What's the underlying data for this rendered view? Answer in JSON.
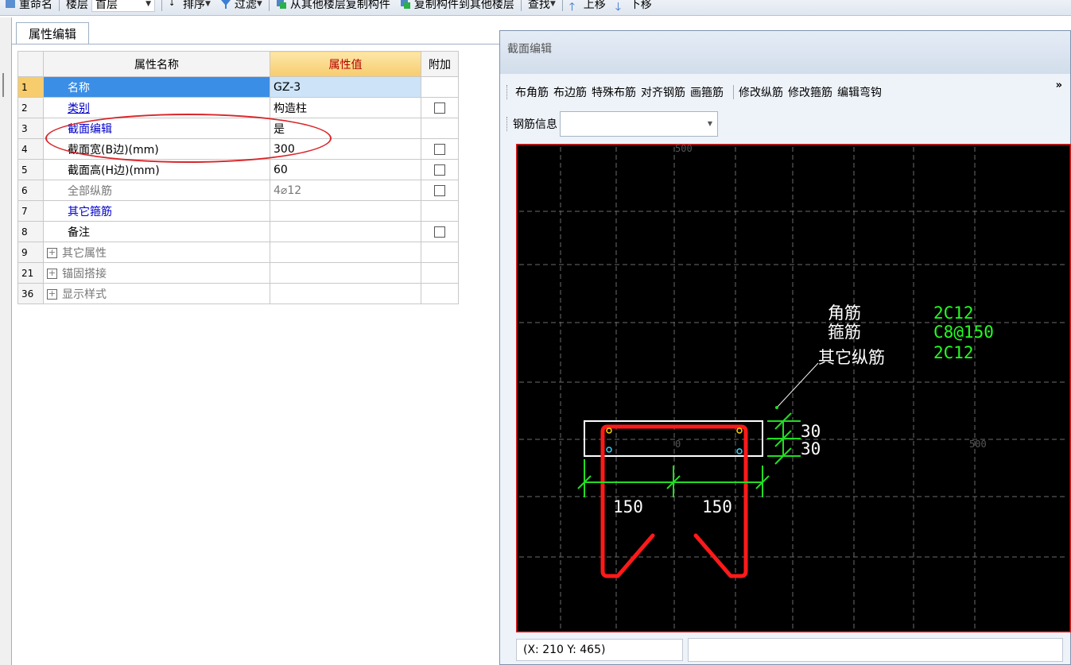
{
  "toolbar": {
    "rename_label": "重命名",
    "floor_label": "楼层",
    "floor_value": "首层",
    "sort_label": "排序",
    "filter_label": "过滤",
    "copy_from_label": "从其他楼层复制构件",
    "copy_to_label": "复制构件到其他楼层",
    "find_label": "查找",
    "move_up_label": "上移",
    "move_down_label": "下移"
  },
  "panel": {
    "tab_label": "属性编辑",
    "headers": {
      "name": "属性名称",
      "value": "属性值",
      "extra": "附加"
    },
    "rows": [
      {
        "num": "1",
        "name": "名称",
        "value": "GZ-3"
      },
      {
        "num": "2",
        "name": "类别",
        "value": "构造柱"
      },
      {
        "num": "3",
        "name": "截面编辑",
        "value": "是"
      },
      {
        "num": "4",
        "name": "截面宽(B边)(mm)",
        "value": "300"
      },
      {
        "num": "5",
        "name": "截面高(H边)(mm)",
        "value": "60"
      },
      {
        "num": "6",
        "name": "全部纵筋",
        "value": "4⌀12"
      },
      {
        "num": "7",
        "name": "其它箍筋",
        "value": ""
      },
      {
        "num": "8",
        "name": "备注",
        "value": ""
      },
      {
        "num": "9",
        "name": "其它属性",
        "value": ""
      },
      {
        "num": "21",
        "name": "锚固搭接",
        "value": ""
      },
      {
        "num": "36",
        "name": "显示样式",
        "value": ""
      }
    ]
  },
  "section_window": {
    "title": "截面编辑",
    "tools": [
      "布角筋",
      "布边筋",
      "特殊布筋",
      "对齐钢筋",
      "画箍筋",
      "修改纵筋",
      "修改箍筋",
      "编辑弯钩"
    ],
    "more": "»",
    "rebar_info_label": "钢筋信息",
    "rebar_info_value": "",
    "status_text": "(X: 210 Y: 465)"
  },
  "drawing": {
    "labels": {
      "corner": "角筋",
      "corner_val": "2C12",
      "stirrup": "箍筋",
      "stirrup_val": "C8@150",
      "other": "其它纵筋",
      "other_val": "2C12"
    },
    "dim_150_left": "150",
    "dim_150_right": "150",
    "dim_30_top": "30",
    "dim_30_bottom": "30",
    "axis_500_top": "500",
    "axis_500_right": "500",
    "axis_0": "0"
  },
  "colors": {
    "accent": "#3b8ee6",
    "highlight_border": "#d9262a",
    "rebar_red": "#ff1a1a",
    "dim_green": "#22dd22",
    "canvas_bg": "#000000"
  }
}
